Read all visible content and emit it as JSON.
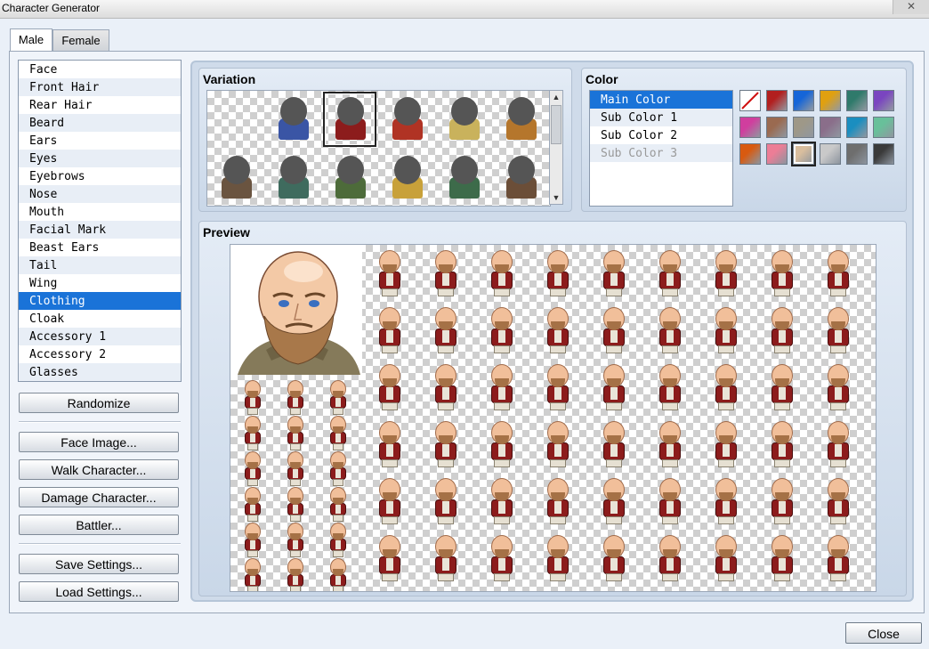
{
  "window": {
    "title": "Character Generator",
    "close_glyph": "✕"
  },
  "tabs": [
    {
      "label": "Male",
      "selected": true
    },
    {
      "label": "Female",
      "selected": false
    }
  ],
  "parts": {
    "selected": "Clothing",
    "items": [
      "Face",
      "Front Hair",
      "Rear Hair",
      "Beard",
      "Ears",
      "Eyes",
      "Eyebrows",
      "Nose",
      "Mouth",
      "Facial Mark",
      "Beast Ears",
      "Tail",
      "Wing",
      "Clothing",
      "Cloak",
      "Accessory 1",
      "Accessory 2",
      "Glasses"
    ]
  },
  "buttons": {
    "randomize": "Randomize",
    "face_image": "Face Image...",
    "walk_character": "Walk Character...",
    "damage_character": "Damage Character...",
    "battler": "Battler...",
    "save_settings": "Save Settings...",
    "load_settings": "Load Settings...",
    "close": "Close"
  },
  "variation": {
    "title": "Variation",
    "selected_index": 2,
    "outfit_colors": [
      "none",
      "#3a55a5",
      "#8c1c1c",
      "#b03324",
      "#c9b25c",
      "#b5762c",
      "#6a5440",
      "#3f6b5e",
      "#4d6b3a",
      "#c8a13a",
      "#3d6b4a",
      "#6b4e38"
    ]
  },
  "color": {
    "title": "Color",
    "slots": [
      {
        "label": "Main Color",
        "selected": true,
        "enabled": true
      },
      {
        "label": "Sub Color 1",
        "selected": false,
        "enabled": true
      },
      {
        "label": "Sub Color 2",
        "selected": false,
        "enabled": true
      },
      {
        "label": "Sub Color 3",
        "selected": false,
        "enabled": false
      }
    ],
    "swatches": [
      "none",
      "#b21f1f",
      "#1565d8",
      "#e0a010",
      "#2f7a6b",
      "#7a45c0",
      "#d03e9e",
      "#9a6a50",
      "#9e9888",
      "#8a6e8a",
      "#1a8ec0",
      "#68c09a",
      "#d85a10",
      "#ec7d96",
      "#d9be9e",
      "#c9c9c9",
      "#6e6e6e",
      "#3a3a3a"
    ],
    "selected_swatch": 14
  },
  "preview": {
    "title": "Preview"
  }
}
